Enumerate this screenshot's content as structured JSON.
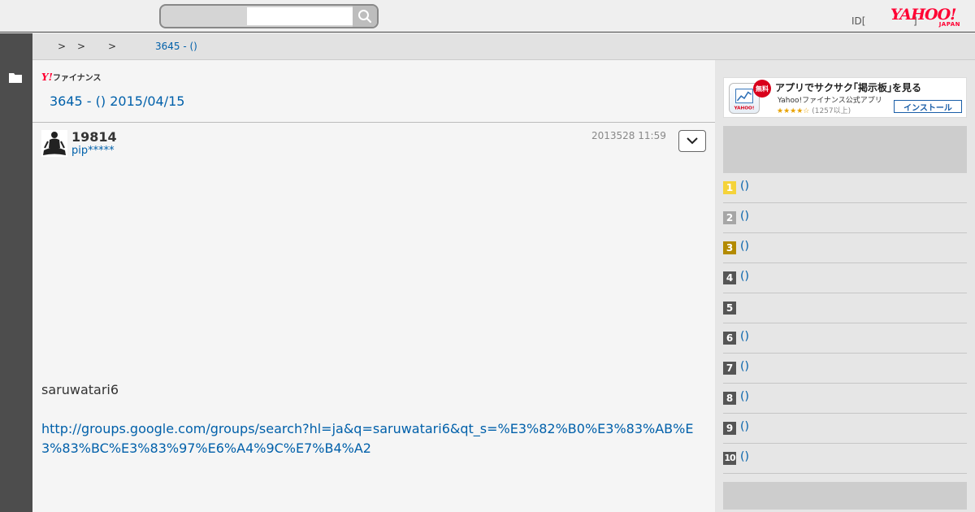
{
  "header": {
    "search_placeholder": "",
    "id_label": "ID[",
    "id_suffix": "]",
    "logo_yahoo": "YAHOO!",
    "logo_japan": "JAPAN"
  },
  "breadcrumb": {
    "separators": [
      ">",
      ">",
      ">"
    ],
    "current": "3645 - ()"
  },
  "main": {
    "fin_logo_y": "Y!",
    "fin_logo_text": "ファイナンス",
    "title": "3645 - () 2015/04/15",
    "post": {
      "number": "19814",
      "user": "pip*****",
      "date": "2013528 11:59",
      "text": "saruwatari6",
      "link": "http://groups.google.com/groups/search?hl=ja&q=saruwatari6&qt_s=%E3%82%B0%E3%83%AB%E3%83%BC%E3%83%97%E6%A4%9C%E7%B4%A2"
    }
  },
  "app_banner": {
    "badge": "無料",
    "title": "アプリでサクサク｢掲示板｣を見る",
    "subtitle": "Yahoo!ファイナンス公式アプリ",
    "stars": "★★★★☆",
    "reviews": "(1257以上)",
    "install_label": "インストール"
  },
  "ranking": [
    {
      "num": "1",
      "text": "()",
      "color": "#f5d33a"
    },
    {
      "num": "2",
      "text": "()",
      "color": "#a6a6a6"
    },
    {
      "num": "3",
      "text": "()",
      "color": "#b38a00"
    },
    {
      "num": "4",
      "text": "()",
      "color": "#555555"
    },
    {
      "num": "5",
      "text": "",
      "color": "#555555"
    },
    {
      "num": "6",
      "text": "()",
      "color": "#555555"
    },
    {
      "num": "7",
      "text": "()",
      "color": "#555555"
    },
    {
      "num": "8",
      "text": "()",
      "color": "#555555"
    },
    {
      "num": "9",
      "text": "()",
      "color": "#555555"
    },
    {
      "num": "10",
      "text": "()",
      "color": "#555555"
    }
  ],
  "colors": {
    "link": "#0060aa",
    "brand_red": "#ff0033"
  },
  "icons": {
    "search": "search-icon",
    "folder": "folder-icon",
    "chevron": "chevron-down-icon"
  }
}
